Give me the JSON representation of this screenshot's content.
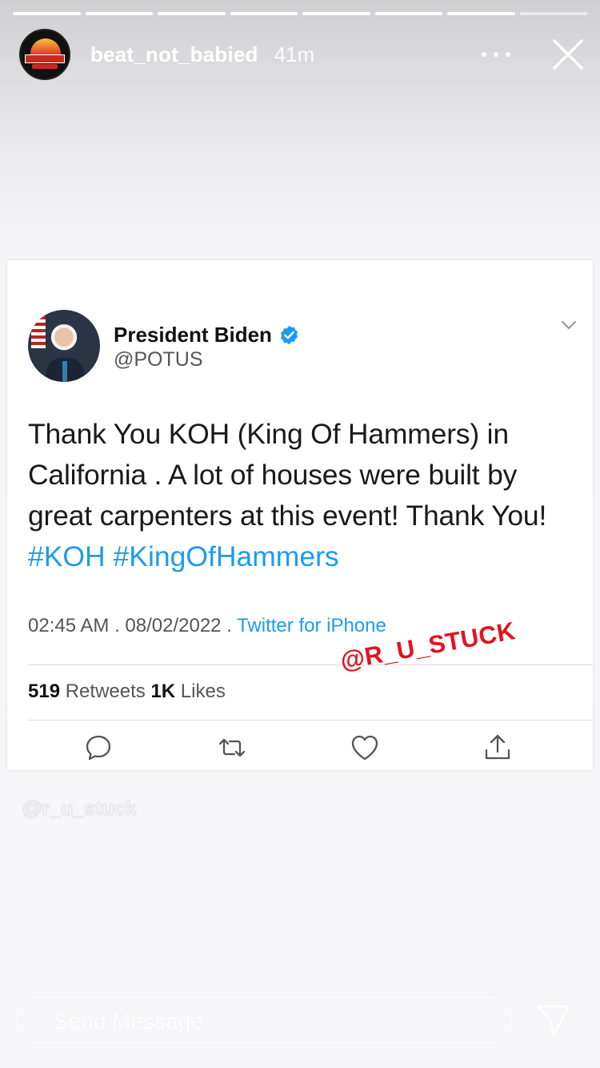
{
  "story": {
    "username": "beat_not_babied",
    "time_ago": "41m",
    "avatar_text": "BEATNOTBABIED",
    "progress_segments": 8,
    "current_segment": 8
  },
  "tweet": {
    "display_name": "President Biden",
    "handle": "@POTUS",
    "body": "Thank You KOH (King Of Hammers) in California . A lot of houses were built by great carpenters at this event! Thank You!",
    "hashtags": [
      "#KOH",
      "#KingOfHammers"
    ],
    "timestamp": "02:45 AM . 08/02/2022 .",
    "source": "Twitter for iPhone",
    "retweets_count": "519",
    "retweets_label": "Retweets",
    "likes_count": "1K",
    "likes_label": "Likes"
  },
  "watermarks": {
    "red": "@R_U_STUCK",
    "ghost": "@r_u_stuck"
  },
  "composer": {
    "placeholder": "Send Message"
  },
  "colors": {
    "twitter_blue": "#1d9bf0",
    "watermark_red": "#e3121e"
  }
}
